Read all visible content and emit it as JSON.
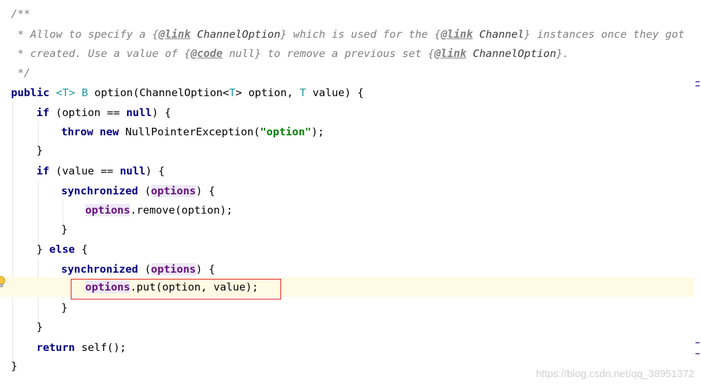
{
  "editor": {
    "doc_open": "/**",
    "doc1_a": " * Allow to specify a ",
    "doc1_tag1": "@link",
    "doc1_ref1": " ChannelOption",
    "doc1_b": " which is used for the ",
    "doc1_tag2": "@link",
    "doc1_ref2": " Channel",
    "doc1_c": " instances once they got",
    "doc2_a": " * created. Use a value of ",
    "doc2_tag1": "@code",
    "doc2_b": " null",
    "doc2_c": " to remove a previous set ",
    "doc2_tag2": "@link",
    "doc2_ref": " ChannelOption",
    "doc2_d": ".",
    "doc_close": " */",
    "kw_public": "public",
    "sig_type_param": "<T>",
    "sig_b": "B",
    "sig_name": "option(ChannelOption<",
    "sig_t1": "T",
    "sig_mid": "> option, ",
    "sig_t2": "T",
    "sig_end": " value) {",
    "kw_if": "if",
    "kw_null": "null",
    "kw_throw": "throw",
    "kw_new": "new",
    "kw_sync": "synchronized",
    "kw_else": "else",
    "kw_return": "return",
    "if1_cond": " (option == ",
    "if_close": ") {",
    "npe": " NullPointerException(",
    "npe_str": "\"option\"",
    "npe_end": ");",
    "brace_close": "}",
    "if2_cond": " (value == ",
    "sync_open": " (",
    "options_field": "options",
    "sync_close": ") {",
    "remove_call": ".remove(option);",
    "else_open_a": "} ",
    "else_open_b": " {",
    "put_call": ".put(option, value);",
    "return_call": " self();"
  },
  "watermark": "https://blog.csdn.net/qq_38951372",
  "colors": {
    "keyword": "#000080",
    "comment": "#808080",
    "field": "#660e7a",
    "string": "#008000",
    "type_param": "#20999d",
    "highlight_box": "#e02020",
    "caret_line": "#fffae3"
  },
  "icons": {
    "gutter": "lightbulb-icon"
  }
}
